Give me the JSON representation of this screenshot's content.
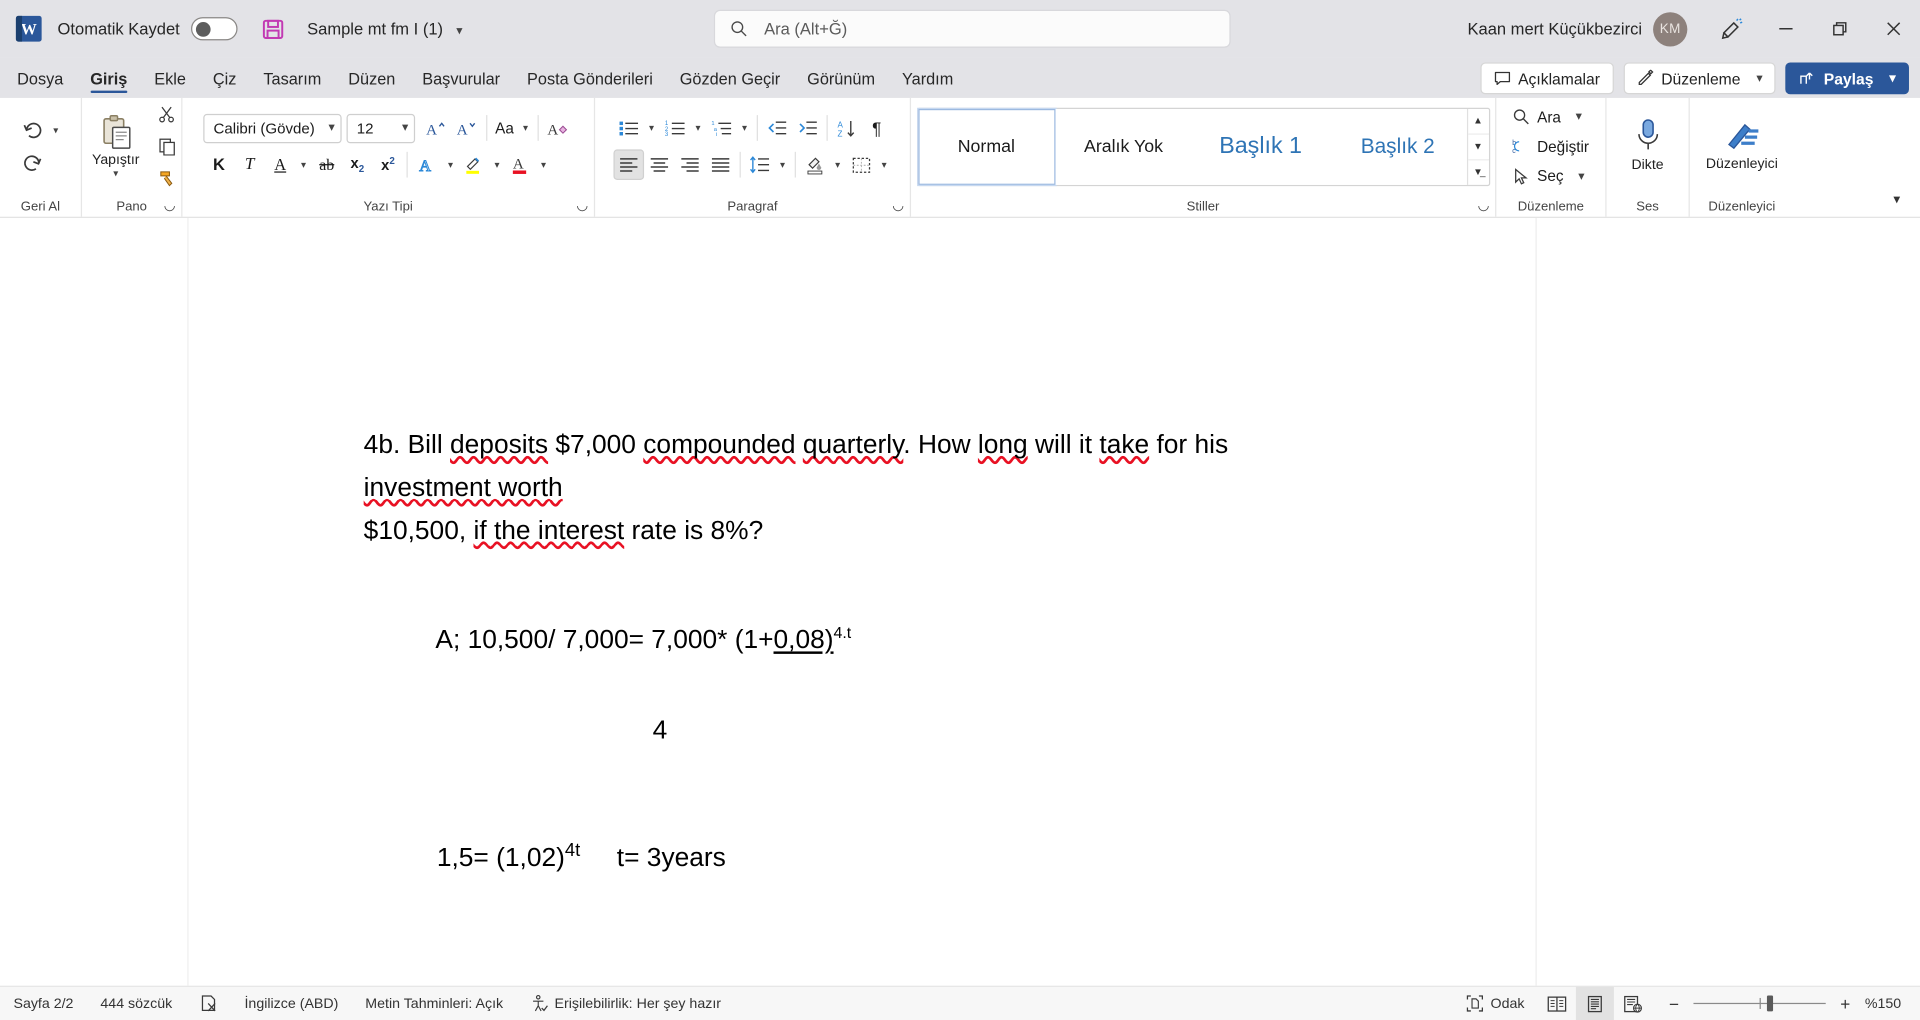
{
  "titlebar": {
    "app_icon": "word-logo",
    "autosave_label": "Otomatik Kaydet",
    "autosave_state": "off",
    "save_icon": "save-icon",
    "document_title": "Sample mt fm I (1)",
    "search_placeholder": "Ara (Alt+Ğ)",
    "user_name": "Kaan mert Küçükbezirci",
    "user_initials": "KM",
    "feedback_icon": "megaphone-icon",
    "minimize": "minimize-icon",
    "restore": "restore-icon",
    "close": "close-icon"
  },
  "ribbon_tabs": {
    "items": [
      {
        "label": "Dosya",
        "active": false
      },
      {
        "label": "Giriş",
        "active": true
      },
      {
        "label": "Ekle",
        "active": false
      },
      {
        "label": "Çiz",
        "active": false
      },
      {
        "label": "Tasarım",
        "active": false
      },
      {
        "label": "Düzen",
        "active": false
      },
      {
        "label": "Başvurular",
        "active": false
      },
      {
        "label": "Posta Gönderileri",
        "active": false
      },
      {
        "label": "Gözden Geçir",
        "active": false
      },
      {
        "label": "Görünüm",
        "active": false
      },
      {
        "label": "Yardım",
        "active": false
      }
    ],
    "comments_label": "Açıklamalar",
    "editing_label": "Düzenleme",
    "share_label": "Paylaş"
  },
  "ribbon": {
    "groups": {
      "undo": "Geri Al",
      "clipboard": "Pano",
      "font": "Yazı Tipi",
      "paragraph": "Paragraf",
      "styles": "Stiller",
      "editing": "Düzenleme",
      "voice": "Ses",
      "editor": "Düzenleyici"
    },
    "clipboard": {
      "paste_label": "Yapıştır",
      "cut_icon": "scissors-icon",
      "copy_icon": "copy-icon",
      "format_painter_icon": "format-painter-icon"
    },
    "font": {
      "family_value": "Calibri (Gövde)",
      "size_value": "12",
      "grow_icon": "grow-font-icon",
      "shrink_icon": "shrink-font-icon",
      "change_case_label": "Aa",
      "clear_format_icon": "clear-formatting-icon",
      "bold_label": "K",
      "italic_label": "T",
      "underline_label": "A",
      "strikethrough_label": "ab",
      "subscript_label": "x",
      "superscript_label": "x",
      "text_effects_label": "A",
      "highlight_icon": "highlight-icon",
      "font_color_label": "A",
      "highlight_color": "#ffff00",
      "font_color": "#e81123"
    },
    "paragraph": {
      "bullets_icon": "bullet-list-icon",
      "numbering_icon": "numbered-list-icon",
      "multilevel_icon": "multilevel-list-icon",
      "decrease_indent_icon": "decrease-indent-icon",
      "increase_indent_icon": "increase-indent-icon",
      "sort_icon": "sort-icon",
      "show_marks_icon": "pilcrow-icon",
      "align_left_icon": "align-left-icon",
      "align_center_icon": "align-center-icon",
      "align_right_icon": "align-right-icon",
      "justify_icon": "justify-icon",
      "line_spacing_icon": "line-spacing-icon",
      "shading_icon": "shading-icon",
      "borders_icon": "borders-icon"
    },
    "styles": {
      "items": [
        {
          "name": "Normal",
          "heading": false,
          "selected": true
        },
        {
          "name": "Aralık Yok",
          "heading": false,
          "selected": false
        },
        {
          "name": "Başlık 1",
          "heading": true,
          "selected": false
        },
        {
          "name": "Başlık 2",
          "heading": true,
          "selected": false
        }
      ],
      "heading_color": "#2e74b5"
    },
    "editing": {
      "find_label": "Ara",
      "replace_label": "Değiştir",
      "select_label": "Seç"
    },
    "voice": {
      "dictate_label": "Dikte",
      "dictate_icon": "microphone-icon"
    },
    "editor": {
      "editor_label": "Düzenleyici",
      "editor_icon": "editor-pen-icon"
    },
    "collapse_icon": "chevron-up-icon"
  },
  "document": {
    "paragraphs": [
      {
        "id": "question",
        "runs": [
          {
            "t": "4b. Bill ",
            "sp": false
          },
          {
            "t": "deposits",
            "sp": true
          },
          {
            "t": " $7,000 ",
            "sp": false
          },
          {
            "t": "compounded",
            "sp": true
          },
          {
            "t": " ",
            "sp": false
          },
          {
            "t": "quarterly",
            "sp": true
          },
          {
            "t": ". How ",
            "sp": false
          },
          {
            "t": "long",
            "sp": true
          },
          {
            "t": " will it ",
            "sp": false
          },
          {
            "t": "take",
            "sp": true
          },
          {
            "t": " for his ",
            "sp": false
          },
          {
            "t": "investment worth",
            "sp": true
          }
        ],
        "line2_runs": [
          {
            "t": "$10,500, ",
            "sp": false
          },
          {
            "t": "if the interest",
            "sp": true
          },
          {
            "t": " rate is 8%?",
            "sp": false
          }
        ]
      }
    ],
    "equation_line1_pre": "A; 10,500/ 7,000= 7,000* (1+",
    "equation_line1_underlined": "0,08)",
    "equation_line1_sup": "4.t",
    "equation_denominator": "4",
    "equation_line2_base": "1,5= (1,02)",
    "equation_line2_sup": "4t",
    "equation_line2_answer": "t= 3years"
  },
  "statusbar": {
    "page": "Sayfa 2/2",
    "words": "444 sözcük",
    "proofing_icon": "proofing-errors-icon",
    "language": "İngilizce (ABD)",
    "text_predictions": "Metin Tahminleri: Açık",
    "accessibility_icon": "accessibility-icon",
    "accessibility": "Erişilebilirlik: Her şey hazır",
    "focus_label": "Odak",
    "focus_icon": "focus-icon",
    "view_read": "read-mode-icon",
    "view_print": "print-layout-icon",
    "view_web": "web-layout-icon",
    "zoom_out": "−",
    "zoom_in": "+",
    "zoom_value": "%150"
  }
}
